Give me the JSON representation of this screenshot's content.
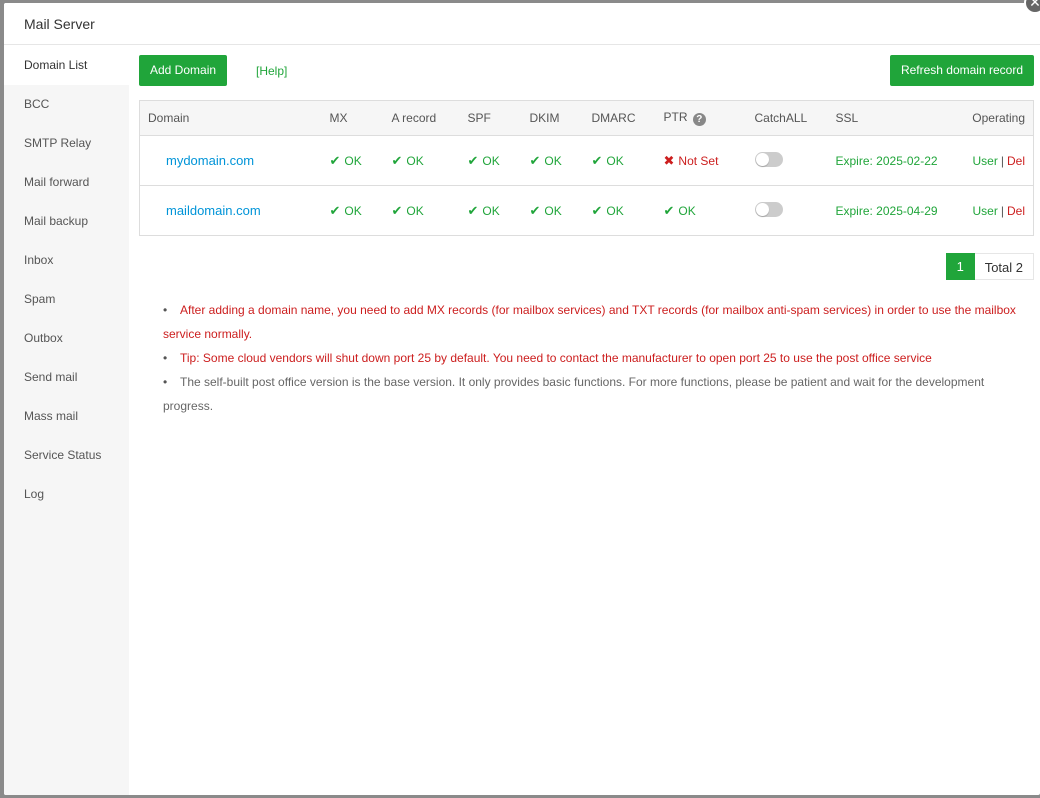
{
  "window": {
    "title": "Mail Server",
    "close_symbol": "✕"
  },
  "sidebar": {
    "items": [
      {
        "label": "Domain List",
        "active": true
      },
      {
        "label": "BCC"
      },
      {
        "label": "SMTP Relay"
      },
      {
        "label": "Mail forward"
      },
      {
        "label": "Mail backup"
      },
      {
        "label": "Inbox"
      },
      {
        "label": "Spam"
      },
      {
        "label": "Outbox"
      },
      {
        "label": "Send mail"
      },
      {
        "label": "Mass mail"
      },
      {
        "label": "Service Status"
      },
      {
        "label": "Log"
      }
    ]
  },
  "toolbar": {
    "add_domain_label": "Add Domain",
    "help_label": "[Help]",
    "refresh_label": "Refresh domain record"
  },
  "table": {
    "headers": {
      "domain": "Domain",
      "mx": "MX",
      "a_record": "A record",
      "spf": "SPF",
      "dkim": "DKIM",
      "dmarc": "DMARC",
      "ptr": "PTR",
      "catchall": "CatchALL",
      "ssl": "SSL",
      "operating": "Operating"
    },
    "help_symbol": "?",
    "check_symbol": "✔",
    "cross_symbol": "✖",
    "rows": [
      {
        "domain": "mydomain.com",
        "mx": "OK",
        "a_record": "OK",
        "spf": "OK",
        "dkim": "OK",
        "dmarc": "OK",
        "ptr": "Not Set",
        "catchall": false,
        "ssl": "Expire: 2025-02-22",
        "user_label": "User",
        "separator": "|",
        "del_label": "Del"
      },
      {
        "domain": "maildomain.com",
        "mx": "OK",
        "a_record": "OK",
        "spf": "OK",
        "dkim": "OK",
        "dmarc": "OK",
        "ptr": "OK",
        "catchall": false,
        "ssl": "Expire: 2025-04-29",
        "user_label": "User",
        "separator": "|",
        "del_label": "Del"
      }
    ]
  },
  "pagination": {
    "current_page": "1",
    "total_label": "Total 2"
  },
  "notes": [
    "After adding a domain name, you need to add MX records (for mailbox services) and TXT records (for mailbox anti-spam services) in order to use the mailbox service normally.",
    "Tip: Some cloud vendors will shut down port 25 by default. You need to contact the manufacturer to open port 25 to use the post office service",
    "The self-built post office version is the base version. It only provides basic functions. For more functions, please be patient and wait for the development progress."
  ],
  "colors": {
    "accent": "#20a53a",
    "danger": "#cc1e1e",
    "link": "#0094d8"
  }
}
